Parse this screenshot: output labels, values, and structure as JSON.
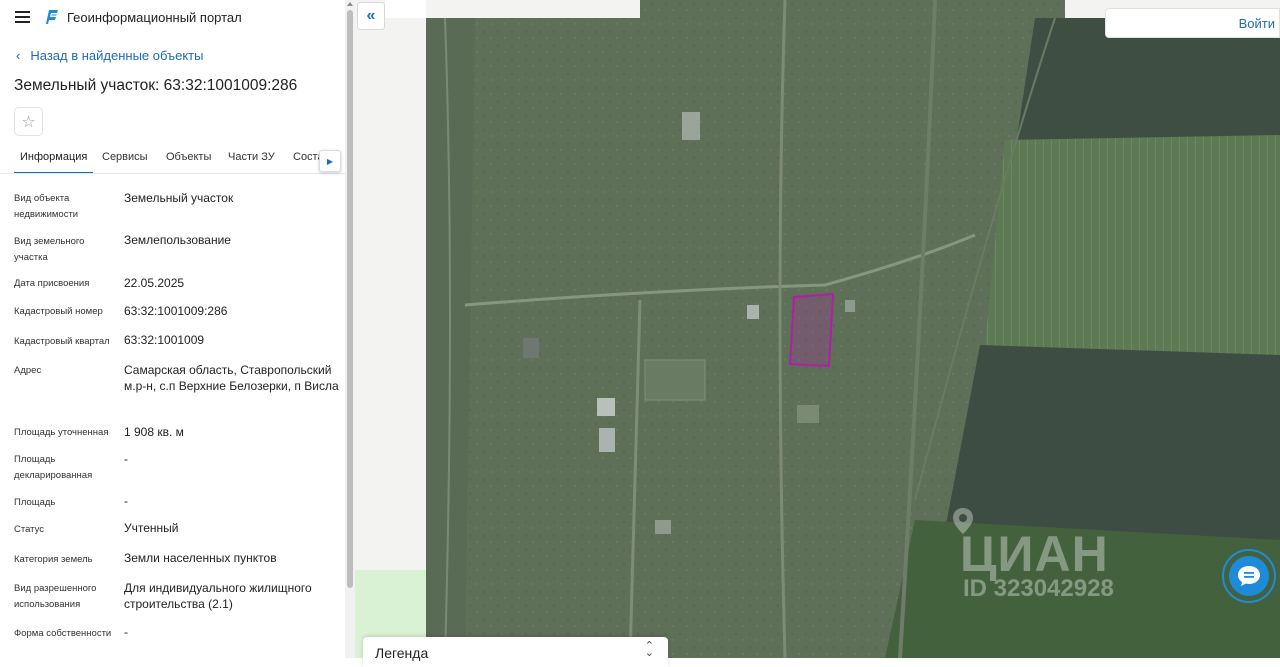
{
  "header": {
    "title": "Геоинформационный портал"
  },
  "nav": {
    "back_label": "Назад в найденные объекты"
  },
  "object": {
    "title": "Земельный участок: 63:32:1001009:286"
  },
  "tabs": [
    {
      "label": "Информация"
    },
    {
      "label": "Сервисы"
    },
    {
      "label": "Объекты"
    },
    {
      "label": "Части ЗУ"
    },
    {
      "label": "Соста"
    }
  ],
  "properties": [
    {
      "label": "Вид объекта недвижимости",
      "value": "Земельный участок"
    },
    {
      "label": "Вид земельного участка",
      "value": "Землепользование"
    },
    {
      "label": "Дата присвоения",
      "value": "22.05.2025"
    },
    {
      "label": "Кадастровый номер",
      "value": "63:32:1001009:286"
    },
    {
      "label": "Кадастровый квартал",
      "value": "63:32:1001009"
    },
    {
      "label": "Адрес",
      "value": "Самарская область, Ставропольский м.р-н, с.п Верхние Белозерки, п Висла"
    },
    {
      "label": "Площадь уточненная",
      "value": "1 908 кв. м"
    },
    {
      "label": "Площадь декларированная",
      "value": "-"
    },
    {
      "label": "Площадь",
      "value": "-"
    },
    {
      "label": "Статус",
      "value": "Учтенный"
    },
    {
      "label": "Категория земель",
      "value": "Земли населенных пунктов"
    },
    {
      "label": "Вид разрешенного использования",
      "value": "Для индивидуального жилищного строительства (2.1)"
    },
    {
      "label": "Форма собственности",
      "value": "-"
    }
  ],
  "map": {
    "login_label": "Войти",
    "legend_label": "Легенда",
    "watermark_brand": "ЦИАН",
    "watermark_id": "ID 323042928",
    "parcel_color": "#b01fa8"
  },
  "icons": {
    "menu": "hamburger-icon",
    "logo": "portal-logo-icon",
    "back": "chevron-left-icon",
    "favorite": "star-icon",
    "tabs_next": "chevron-right-icon",
    "collapse": "double-chevron-left-icon",
    "chat": "chat-icon"
  }
}
